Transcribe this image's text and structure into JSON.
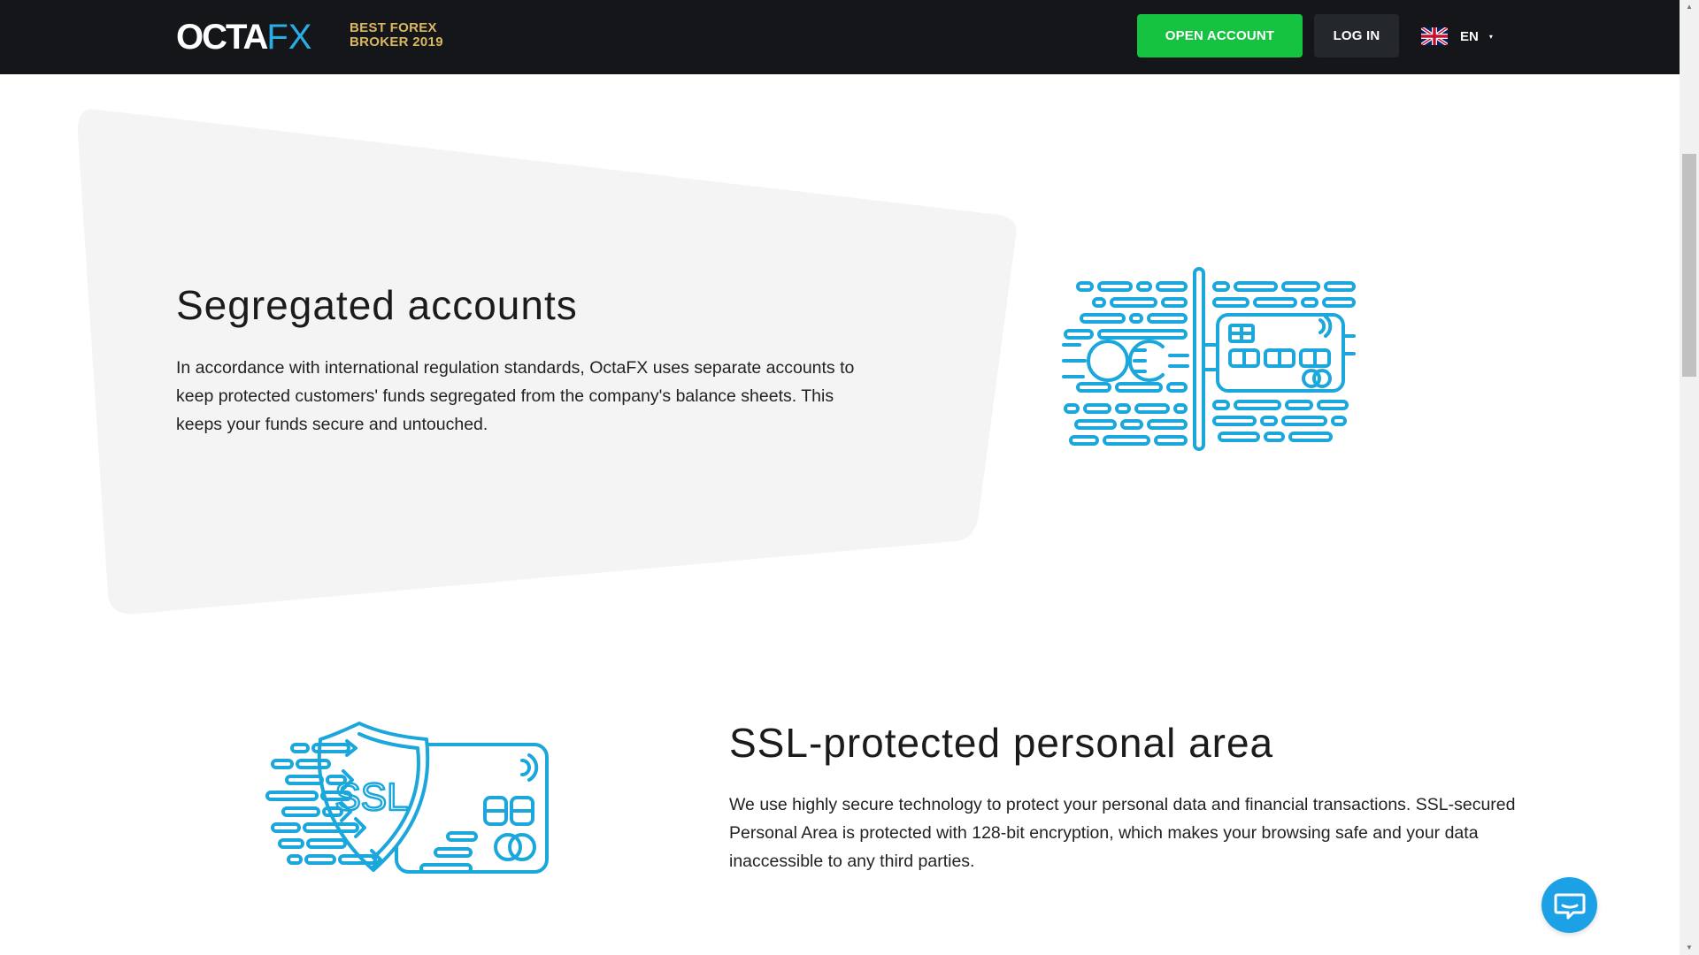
{
  "header": {
    "logo": {
      "part1": "OCTA",
      "part2": "FX"
    },
    "award_line1": "BEST FOREX",
    "award_line2": "BROKER 2019",
    "open_account_label": "OPEN ACCOUNT",
    "login_label": "LOG IN",
    "language": {
      "code": "EN",
      "flag": "uk-flag-icon",
      "caret": "▾"
    }
  },
  "sections": [
    {
      "title": "Segregated accounts",
      "text": "In accordance with international regulation standards, OctaFX uses separate accounts to keep protected customers' funds segregated from the company's balance sheets. This keeps your funds secure and untouched.",
      "icon": "segregated-accounts-illustration"
    },
    {
      "title": "SSL-protected personal area",
      "text": "We use highly secure technology to protect your personal data and financial transactions. SSL-secured Personal Area is protected with 128-bit encryption, which makes your browsing safe and your data inaccessible to any third parties.",
      "icon": "ssl-shield-illustration",
      "illustration_text": "SSL"
    }
  ],
  "chat": {
    "icon": "chat-bubble-icon"
  },
  "scrollbar": {
    "up": "▲",
    "down": "▼"
  },
  "colors": {
    "header_bg": "#141619",
    "brand_blue": "#27aee6",
    "award_gold": "#d9b863",
    "open_account_green": "#16c341",
    "login_bg": "#24272c",
    "illustration_stroke": "#1ba7dc",
    "shape_bg": "#f4f4f4",
    "chat_bg": "#1da1e6"
  }
}
